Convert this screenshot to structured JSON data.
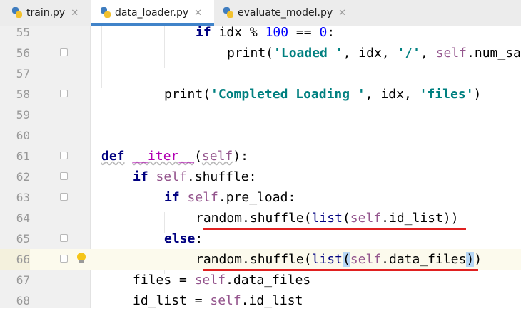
{
  "tabs": [
    {
      "label": "train.py",
      "close": "✕"
    },
    {
      "label": "data_loader.py",
      "close": "✕"
    },
    {
      "label": "evaluate_model.py",
      "close": "✕"
    }
  ],
  "lines": [
    {
      "num": "55"
    },
    {
      "num": "56"
    },
    {
      "num": "57"
    },
    {
      "num": "58"
    },
    {
      "num": "59"
    },
    {
      "num": "60"
    },
    {
      "num": "61"
    },
    {
      "num": "62"
    },
    {
      "num": "63"
    },
    {
      "num": "64"
    },
    {
      "num": "65"
    },
    {
      "num": "66"
    },
    {
      "num": "67"
    },
    {
      "num": "68"
    }
  ],
  "code": {
    "if": "if",
    "idx": "idx",
    "mod": " % ",
    "hundred": "100",
    "eqeq": " == ",
    "zero": "0",
    "colon": ":",
    "print": "print",
    "lparen": "(",
    "rparen": ")",
    "s_loaded": "'Loaded '",
    "comma_sp": ", ",
    "s_slash": "'/'",
    "self": "self",
    "num_samples": ".num_sa",
    "s_completed": "'Completed Loading '",
    "s_files": "'files'",
    "def": "def",
    "iter": "__iter__",
    "shuffle": ".shuffle",
    "pre_load": ".pre_load",
    "random": "random",
    "list": "list",
    "id_list_attr": ".id_list",
    "dot": ".",
    "data_files_name": "data_files",
    "else": "else",
    "files": "files",
    "id_list_var": "id_list",
    "assign": " = ",
    "data_files_attr": ".data_files"
  }
}
